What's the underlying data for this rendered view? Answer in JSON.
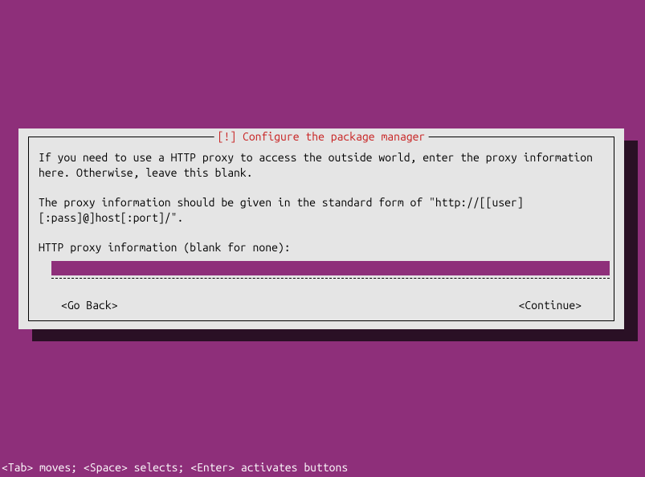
{
  "dialog": {
    "title": "[!] Configure the package manager",
    "paragraph1": "If you need to use a HTTP proxy to access the outside world, enter the proxy information here. Otherwise, leave this blank.",
    "paragraph2": "The proxy information should be given in the standard form of \"http://[[user][:pass]@]host[:port]/\".",
    "prompt": "HTTP proxy information (blank for none):",
    "input_value": "",
    "buttons": {
      "go_back": "<Go Back>",
      "continue": "<Continue>"
    }
  },
  "footer": {
    "hint": "<Tab> moves; <Space> selects; <Enter> activates buttons"
  }
}
